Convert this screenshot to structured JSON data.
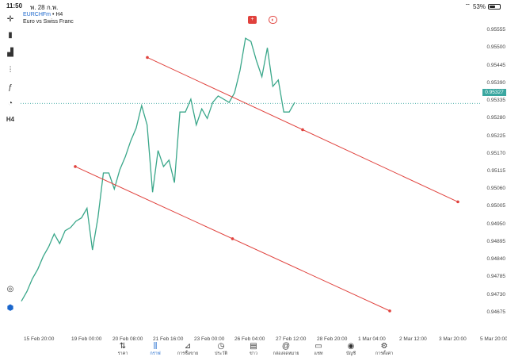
{
  "status_bar": {
    "time": "11:50",
    "date": "พ. 28 ก.พ.",
    "battery": "53%"
  },
  "symbol": {
    "name": "EURCHFm",
    "timeframe": "• H4",
    "description": "Euro vs Swiss Franc"
  },
  "price_axis": [
    "0.95555",
    "0.95500",
    "0.95445",
    "0.95390",
    "0.95335",
    "0.95280",
    "0.95225",
    "0.95170",
    "0.95115",
    "0.95060",
    "0.95005",
    "0.94950",
    "0.94895",
    "0.94840",
    "0.94785",
    "0.94730",
    "0.94675"
  ],
  "current_price": "0.95327",
  "time_axis": [
    "15 Feb 20:00",
    "19 Feb 00:00",
    "20 Feb 08:00",
    "21 Feb 16:00",
    "23 Feb 00:00",
    "26 Feb 04:00",
    "27 Feb 12:00",
    "28 Feb 20:00",
    "1 Mar 04:00",
    "2 Mar 12:00",
    "3 Mar 20:00",
    "5 Mar 20:00"
  ],
  "toolbar": [
    "crosshair-icon",
    "candles-icon",
    "bars-icon",
    "indicators-icon",
    "function-icon",
    "objects-icon",
    "timeframe-label"
  ],
  "toolbar_labels": {
    "timeframe": "H4"
  },
  "nav": [
    {
      "label": "ราคา",
      "icon": "quotes-icon"
    },
    {
      "label": "กราฟ",
      "icon": "chart-icon",
      "active": true
    },
    {
      "label": "การซื้อขาย",
      "icon": "trade-icon"
    },
    {
      "label": "ประวัติ",
      "icon": "history-icon"
    },
    {
      "label": "ข่าว",
      "icon": "news-icon"
    },
    {
      "label": "กล่องจดหมาย",
      "icon": "mailbox-icon"
    },
    {
      "label": "แชท",
      "icon": "chat-icon"
    },
    {
      "label": "บัญชี",
      "icon": "accounts-icon"
    },
    {
      "label": "การตั้งค่า",
      "icon": "settings-icon"
    }
  ],
  "colors": {
    "line": "#3aa78a",
    "channel": "#e0413c",
    "accent": "#1a66cc",
    "price_line": "#3aa7a0"
  },
  "chart_data": {
    "type": "line",
    "series": [
      {
        "values": [
          0.9471,
          0.9474,
          0.9478,
          0.9481,
          0.9485,
          0.9488,
          0.9492,
          0.9489,
          0.9493,
          0.9494,
          0.9496,
          0.9497,
          0.95,
          0.9487,
          0.9497,
          0.9511,
          0.9511,
          0.9506,
          0.9512,
          0.9516,
          0.9521,
          0.9525,
          0.9532,
          0.9526,
          0.9505,
          0.9518,
          0.9513,
          0.9515,
          0.9508,
          0.953,
          0.953,
          0.9534,
          0.9526,
          0.9531,
          0.9528,
          0.9533,
          0.9535,
          0.9534,
          0.9533,
          0.9536,
          0.9543,
          0.9553,
          0.9552,
          0.9546,
          0.9541,
          0.955,
          0.9538,
          0.954,
          0.953,
          0.953,
          0.9533
        ]
      }
    ],
    "channel_lines": [
      {
        "from": [
          "21 Feb 16:00",
          0.9547
        ],
        "to": [
          "3 Mar 20:00",
          0.9502
        ]
      },
      {
        "from": [
          "19 Feb 00:00",
          0.9513
        ],
        "to": [
          "5 Mar 20:00",
          0.9468
        ]
      }
    ],
    "ylim": [
      0.9465,
      0.9558
    ]
  }
}
